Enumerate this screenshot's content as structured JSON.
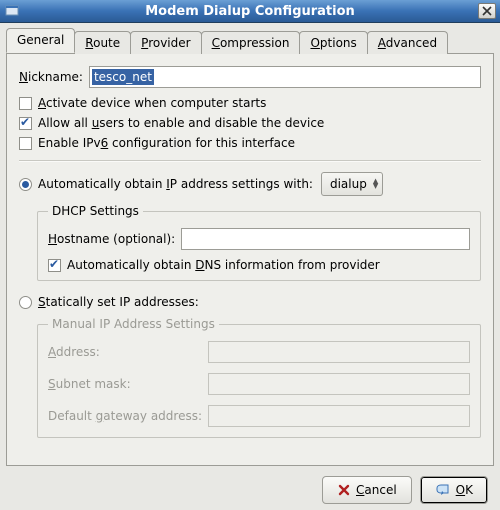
{
  "window": {
    "title": "Modem Dialup Configuration"
  },
  "tabs": {
    "general": "General",
    "route_u": "R",
    "route_rest": "oute",
    "provider_u": "P",
    "provider_rest": "rovider",
    "compression_u": "C",
    "compression_rest": "ompression",
    "options_u": "O",
    "options_rest": "ptions",
    "advanced_u": "A",
    "advanced_rest": "dvanced"
  },
  "general": {
    "nickname_pre": "N",
    "nickname_rest": "ickname:",
    "nickname_value": "tesco_net",
    "activate_u": "A",
    "activate_rest": "ctivate device when computer starts",
    "allow_pre": "Allow all ",
    "allow_u": "u",
    "allow_post": "sers to enable and disable the device",
    "ipv6_pre": "Enable IPv",
    "ipv6_u": "6",
    "ipv6_post": " configuration for this interface",
    "auto_pre": "Automatically obtain ",
    "auto_u": "I",
    "auto_post": "P address settings with:",
    "dialup_option": "dialup",
    "dhcp_legend": "DHCP Settings",
    "hostname_pre": "",
    "hostname_u": "H",
    "hostname_post": "ostname (optional):",
    "hostname_value": "",
    "autodns_pre": "Automatically obtain ",
    "autodns_u": "D",
    "autodns_post": "NS information from provider",
    "static_pre": "",
    "static_u": "S",
    "static_post": "tatically set IP addresses:",
    "manual_legend": "Manual IP Address Settings",
    "address_u": "A",
    "address_rest": "ddress:",
    "subnet_u": "S",
    "subnet_rest": "ubnet mask:",
    "gateway_pre": "Default ",
    "gateway_u": "g",
    "gateway_post": "ateway address:",
    "address_value": "",
    "subnet_value": "",
    "gateway_value": ""
  },
  "buttons": {
    "cancel_u": "C",
    "cancel_rest": "ancel",
    "ok_u": "O",
    "ok_rest": "K"
  }
}
